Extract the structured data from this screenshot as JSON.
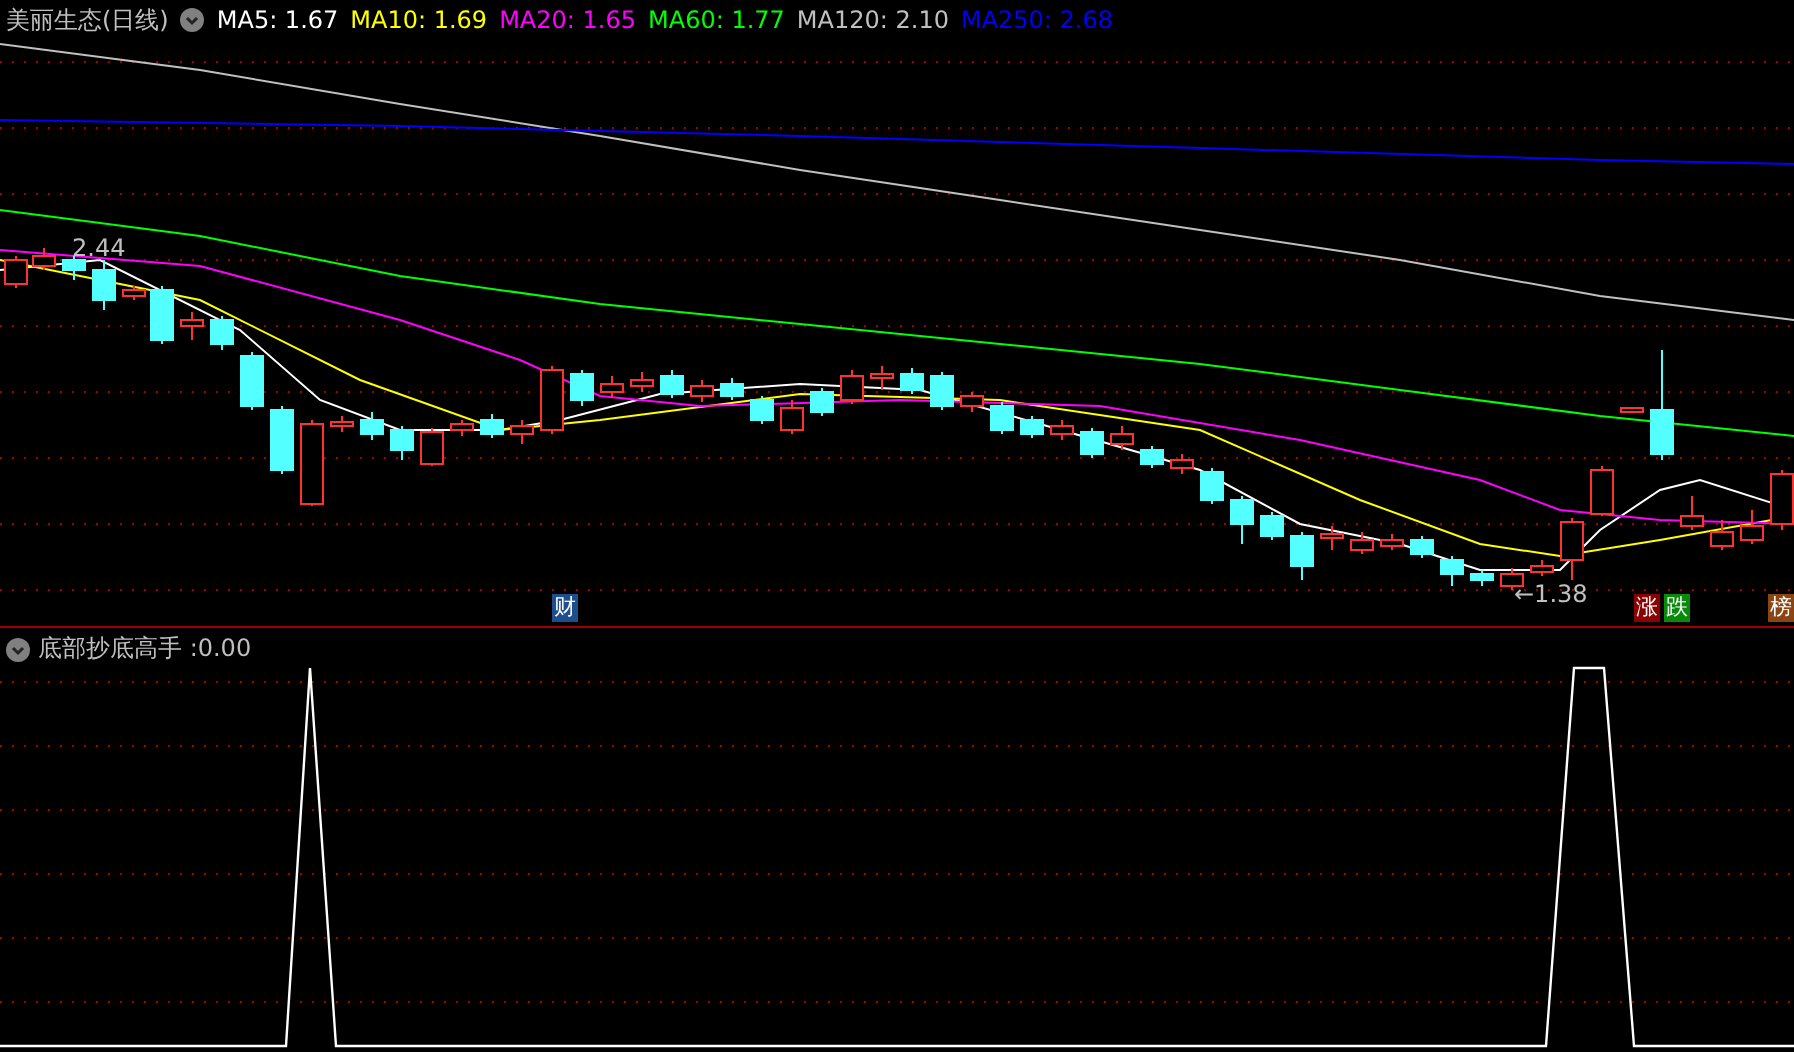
{
  "window": {
    "title": "美丽生态(日线)"
  },
  "main_chart": {
    "indicators": [
      {
        "label": "MA5: 1.67",
        "color": "#ffffff"
      },
      {
        "label": "MA10: 1.69",
        "color": "#ffff00"
      },
      {
        "label": "MA20: 1.65",
        "color": "#ff00ff"
      },
      {
        "label": "MA60: 1.77",
        "color": "#00ff00"
      },
      {
        "label": "MA120: 2.10",
        "color": "#c0c0c0"
      },
      {
        "label": "MA250: 2.68",
        "color": "#0000ff"
      }
    ],
    "high_label": "2.44",
    "low_label": "←1.38",
    "badges": [
      {
        "text": "财",
        "color": "#1f4e8c"
      },
      {
        "text": "涨",
        "color": "#8b0000"
      },
      {
        "text": "跌",
        "color": "#0a8a0a"
      },
      {
        "text": "榜",
        "color": "#8b4513"
      }
    ]
  },
  "sub_chart": {
    "title": "底部抄底高手 :0.00"
  }
}
